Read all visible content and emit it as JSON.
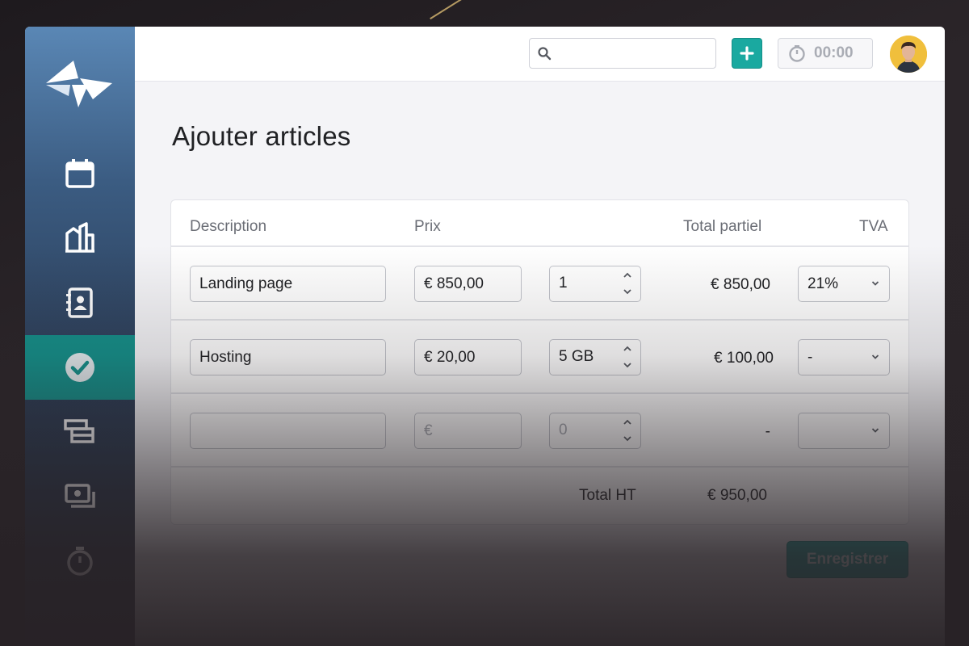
{
  "topbar": {
    "search_placeholder": "",
    "timer_value": "00:00"
  },
  "sidebar": {
    "items": [
      {
        "icon": "calendar-icon"
      },
      {
        "icon": "buildings-icon"
      },
      {
        "icon": "contacts-book-icon"
      },
      {
        "icon": "check-circle-icon",
        "active": true
      },
      {
        "icon": "stacked-cards-icon"
      },
      {
        "icon": "money-icon"
      },
      {
        "icon": "stopwatch-icon"
      }
    ]
  },
  "page": {
    "title": "Ajouter articles"
  },
  "table": {
    "headers": {
      "description": "Description",
      "price": "Prix",
      "subtotal": "Total partiel",
      "vat": "TVA"
    },
    "rows": [
      {
        "description": "Landing page",
        "price": "€ 850,00",
        "quantity": "1",
        "subtotal": "€ 850,00",
        "vat": "21%"
      },
      {
        "description": "Hosting",
        "price": "€ 20,00",
        "quantity": "5 GB",
        "subtotal": "€ 100,00",
        "vat": "-"
      },
      {
        "description": "",
        "price_placeholder": "€",
        "quantity_placeholder": "0",
        "subtotal": "-",
        "vat": ""
      }
    ],
    "total_label": "Total HT",
    "total_value": "€ 950,00"
  },
  "actions": {
    "save_label": "Enregistrer"
  },
  "colors": {
    "accent": "#1aa9a0",
    "sidebar_top": "#5a87b5",
    "sidebar_active": "#13908a"
  }
}
